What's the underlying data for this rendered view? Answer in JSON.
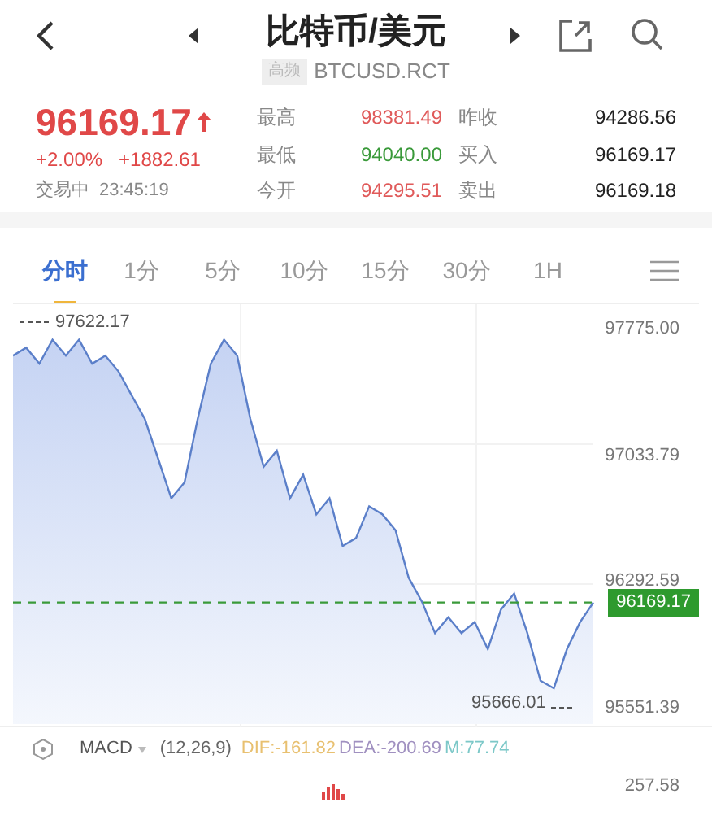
{
  "header": {
    "title": "比特币/美元",
    "badge": "高频",
    "code": "BTCUSD.RCT"
  },
  "quote": {
    "price": "96169.17",
    "change_pct": "+2.00%",
    "change": "+1882.61",
    "status": "交易中",
    "time": "23:45:19"
  },
  "stats": [
    {
      "label": "最高",
      "value": "98381.49",
      "color": "#e05a5a"
    },
    {
      "label": "昨收",
      "value": "94286.56",
      "color": "#222222"
    },
    {
      "label": "最低",
      "value": "94040.00",
      "color": "#3a9a3a"
    },
    {
      "label": "买入",
      "value": "96169.17",
      "color": "#222222"
    },
    {
      "label": "今开",
      "value": "94295.51",
      "color": "#e05a5a"
    },
    {
      "label": "卖出",
      "value": "96169.18",
      "color": "#222222"
    }
  ],
  "tabs": [
    {
      "label": "分时",
      "selected": true
    },
    {
      "label": "1分",
      "selected": false
    },
    {
      "label": "5分",
      "selected": false
    },
    {
      "label": "10分",
      "selected": false
    },
    {
      "label": "15分",
      "selected": false
    },
    {
      "label": "30分",
      "selected": false
    },
    {
      "label": "1H",
      "selected": false
    }
  ],
  "chart": {
    "chart_data": {
      "type": "area",
      "ref_lines": [
        {
          "axis": "y",
          "value": 96169.17,
          "color": "#3a9a3a"
        }
      ],
      "ylim": [
        95551.39,
        97775.0
      ],
      "yticks": [
        {
          "value": 97775.0,
          "label": "97775.00"
        },
        {
          "value": 97033.79,
          "label": "97033.79"
        },
        {
          "value": 96292.59,
          "label": "96292.59"
        },
        {
          "value": 95551.39,
          "label": "95551.39"
        }
      ],
      "series": [
        {
          "color": "#5b7fc9",
          "values": [
            97617,
            97663,
            97570,
            97710,
            97617,
            97710,
            97570,
            97617,
            97524,
            97384,
            97245,
            97012,
            96780,
            96873,
            97245,
            97570,
            97710,
            97617,
            97245,
            96966,
            97059,
            96780,
            96919,
            96686,
            96780,
            96500,
            96547,
            96733,
            96686,
            96593,
            96314,
            96175,
            95989,
            96082,
            95989,
            96054,
            95896,
            96128,
            96221,
            95989,
            95710,
            95666,
            95896,
            96054,
            96169
          ]
        }
      ]
    },
    "high_label": "97622.17",
    "low_label": "95666.01",
    "current": "96169.17"
  },
  "macd": {
    "name": "MACD",
    "params": "(12,26,9)",
    "dif": "DIF:-161.82",
    "dea": "DEA:-200.69",
    "m": "M:77.74",
    "top_label": "257.58"
  }
}
